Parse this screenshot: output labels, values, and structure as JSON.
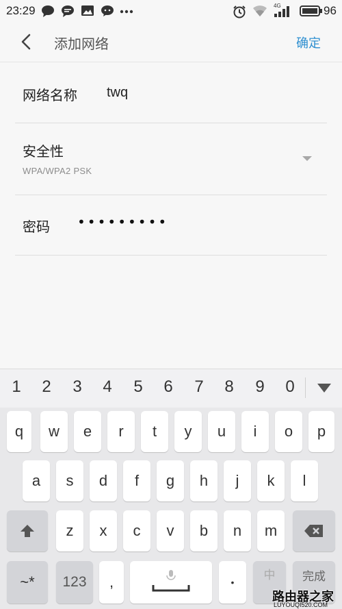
{
  "status_bar": {
    "time": "23:29",
    "network_badge": "4G",
    "battery_percent": "96",
    "icons": [
      "message-bubble-icon",
      "chat-icon",
      "image-icon",
      "wechat-icon",
      "more-dots-icon",
      "alarm-icon",
      "wifi-icon",
      "signal-icon",
      "battery-icon"
    ]
  },
  "header": {
    "back_icon": "chevron-left-icon",
    "title": "添加网络",
    "confirm_label": "确定"
  },
  "form": {
    "network_name_label": "网络名称",
    "network_name_value": "twq",
    "security_label": "安全性",
    "security_value": "WPA/WPA2 PSK",
    "password_label": "密码",
    "password_value": "•••••••••"
  },
  "keyboard": {
    "number_row": [
      "1",
      "2",
      "3",
      "4",
      "5",
      "6",
      "7",
      "8",
      "9",
      "0"
    ],
    "row1": [
      "q",
      "w",
      "e",
      "r",
      "t",
      "y",
      "u",
      "i",
      "o",
      "p"
    ],
    "row2": [
      "a",
      "s",
      "d",
      "f",
      "g",
      "h",
      "j",
      "k",
      "l"
    ],
    "row3": [
      "z",
      "x",
      "c",
      "v",
      "b",
      "n",
      "m"
    ],
    "symbols_key": "~*",
    "numbers_key": "123",
    "comma_key": ",",
    "period_key": "•",
    "lang_key": "中",
    "done_key": "完成"
  },
  "watermark": {
    "text": "路由器之家",
    "url": "LUYOUQI520.COM"
  },
  "colors": {
    "accent": "#2e8fd0",
    "background": "#f7f7f7",
    "keyboard_bg": "#e8e8ea"
  }
}
